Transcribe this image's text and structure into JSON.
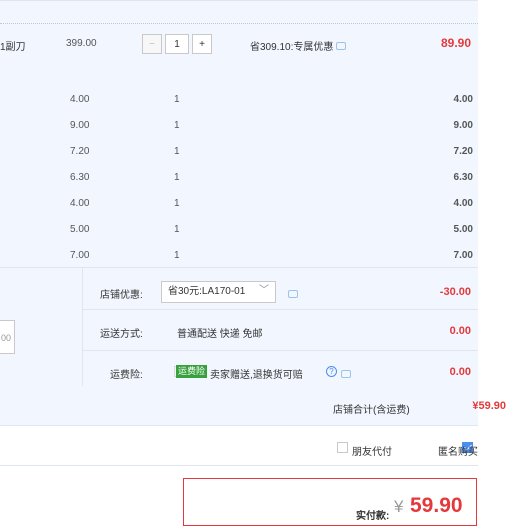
{
  "item": {
    "name_fragment": "1副刀",
    "price": "399.00",
    "quantity": "1",
    "minus": "−",
    "plus": "+",
    "promotion": "省309.10:专属优惠",
    "subtotal": "89.90"
  },
  "sub_items": [
    {
      "price": "4.00",
      "qty": "1",
      "sum": "4.00"
    },
    {
      "price": "9.00",
      "qty": "1",
      "sum": "9.00"
    },
    {
      "price": "7.20",
      "qty": "1",
      "sum": "7.20"
    },
    {
      "price": "6.30",
      "qty": "1",
      "sum": "6.30"
    },
    {
      "price": "4.00",
      "qty": "1",
      "sum": "4.00"
    },
    {
      "price": "5.00",
      "qty": "1",
      "sum": "5.00"
    },
    {
      "price": "7.00",
      "qty": "1",
      "sum": "7.00"
    }
  ],
  "shop": {
    "coupon_label": "店铺优惠:",
    "coupon_value": "省30元:LA170-01",
    "coupon_amount": "-30.00",
    "shipping_label": "运送方式:",
    "shipping_value": "普通配送 快递 免邮",
    "shipping_amount": "0.00",
    "insurance_label": "运费险:",
    "insurance_tag": "运费险",
    "insurance_text": "卖家赠送,退换货可赔",
    "insurance_amount": "0.00",
    "left_input_text": "00",
    "total_label": "店铺合计(含运费)",
    "total_value": "¥59.90"
  },
  "options": {
    "friend_pay": "朋友代付",
    "anonymous": "匿名购买",
    "anonymous_checked": true
  },
  "pay": {
    "label": "实付款:",
    "currency": "¥",
    "amount": "59.90"
  },
  "colors": {
    "accent_red": "#e4393c",
    "light_blue_bg": "#f2f7ff",
    "checkbox_blue": "#4a8ef0",
    "tag_green": "#38a13e"
  }
}
